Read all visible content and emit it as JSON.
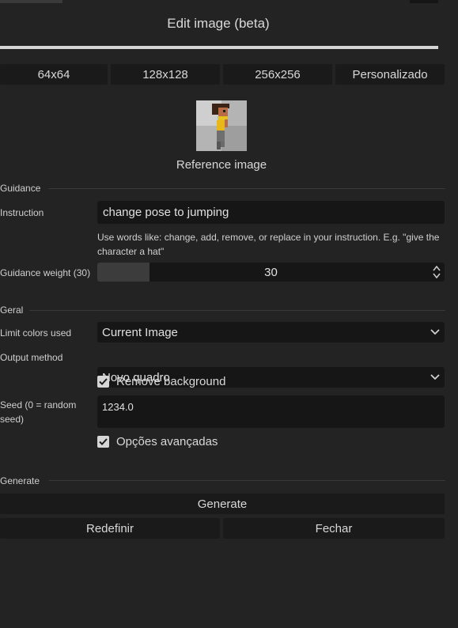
{
  "header": {
    "title": "Edit image (beta)"
  },
  "sizes": [
    "64x64",
    "128x128",
    "256x256",
    "Personalizado"
  ],
  "reference": {
    "caption": "Reference image"
  },
  "guidance": {
    "section_label": "Guidance",
    "instruction_label": "Instruction",
    "instruction_value": "change pose to jumping",
    "hint": "Use words like: change, add, remove, or replace in your instruction. E.g. \"give the character a hat\"",
    "weight_label": "Guidance weight (30)",
    "weight_value": "30",
    "weight_fraction": 0.15
  },
  "geral": {
    "section_label": "Geral",
    "limit_colors_label": "Limit colors used",
    "limit_colors_value": "Current Image",
    "output_method_label": "Output method",
    "output_method_value": "Novo quadro",
    "remove_background_label": "Remove background",
    "remove_background_checked": true,
    "seed_label": "Seed (0 = random seed)",
    "seed_value": "1234.0",
    "advanced_label": "Opções avançadas",
    "advanced_checked": true
  },
  "generate": {
    "section_label": "Generate",
    "generate_label": "Generate",
    "reset_label": "Redefinir",
    "close_label": "Fechar"
  },
  "colors": {
    "background": "#232323",
    "button": "#1a1a1a",
    "input": "#161616",
    "text": "#d8d8d8"
  }
}
